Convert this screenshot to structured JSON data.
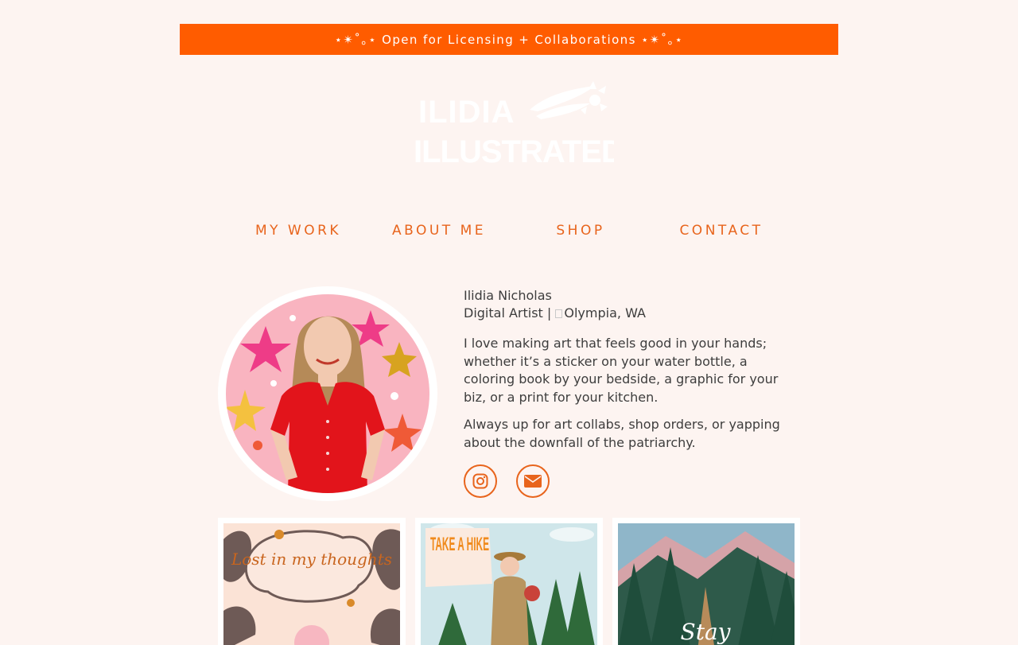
{
  "banner": {
    "text": "⋆✴︎˚｡⋆ Open for Licensing + Collaborations ⋆✴︎˚｡⋆"
  },
  "logo": {
    "line1": "ILIDIA",
    "line2": "ILLUSTRATED"
  },
  "nav": {
    "items": [
      {
        "label": "MY WORK"
      },
      {
        "label": "ABOUT ME"
      },
      {
        "label": "SHOP"
      },
      {
        "label": "CONTACT"
      }
    ]
  },
  "profile": {
    "name": "Ilidia Nicholas",
    "role": "Digital Artist | ",
    "location": "Olympia, WA",
    "paragraph1": "I love making art that feels good in your hands; whether it’s a sticker on your water bottle, a coloring book by your bedside, a graphic for your biz, or a print for your kitchen.",
    "paragraph2": "Always up for art collabs, shop orders, or yapping about the downfall of the patriarchy."
  },
  "social": {
    "instagram_icon": "instagram-icon",
    "email_icon": "envelope-icon"
  },
  "gallery": [
    {
      "lettering": "Lost in my thoughts"
    },
    {
      "lettering": "TAKE A HIKE"
    },
    {
      "lettering": "Stay"
    }
  ],
  "colors": {
    "accent": "#ff5c00",
    "nav": "#e8641c",
    "background": "#fdf4f1"
  }
}
